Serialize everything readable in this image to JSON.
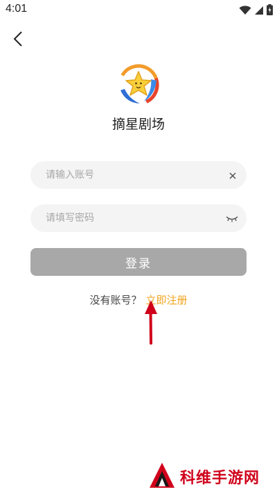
{
  "status_bar": {
    "time": "4:01",
    "icons": [
      "wifi-icon",
      "cellular-signal-icon",
      "battery-charging-icon"
    ]
  },
  "nav": {
    "back_icon": "chevron-left-icon"
  },
  "brand": {
    "app_name": "摘星剧场",
    "logo_icon": "star-logo-icon"
  },
  "form": {
    "account": {
      "placeholder": "请输入账号",
      "value": ""
    },
    "password": {
      "placeholder": "请填写密码",
      "value": ""
    },
    "login_label": "登录"
  },
  "register": {
    "prompt": "没有账号？",
    "link_label": "立即注册"
  },
  "watermark": {
    "text": "科维手游网"
  },
  "colors": {
    "accent_link": "#f0a31c",
    "login_button": "#a8a8a8",
    "input_bg": "#f4f4f4",
    "annotation_arrow": "#d0021b",
    "watermark": "#d0021b"
  }
}
